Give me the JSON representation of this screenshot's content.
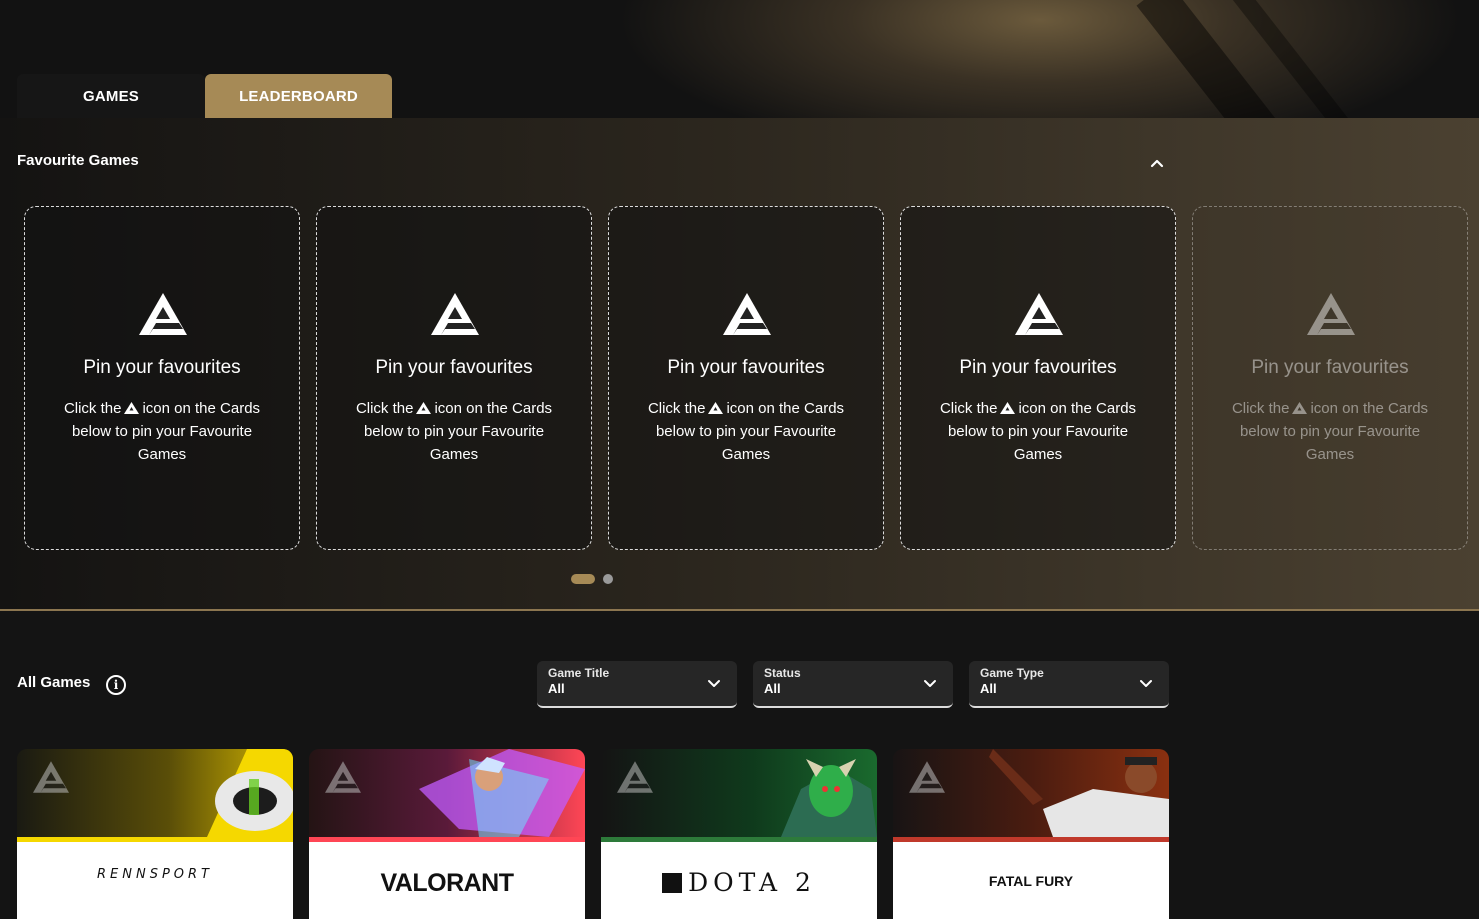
{
  "tabs": [
    {
      "label": "GAMES",
      "active": false
    },
    {
      "label": "LEADERBOARD",
      "active": true
    }
  ],
  "favourites": {
    "title": "Favourite Games",
    "collapse_icon": "chevron-up-icon",
    "card": {
      "title": "Pin your favourites",
      "desc_before": "Click the",
      "desc_after": "icon on the Cards below to pin your Favourite Games",
      "icon": "pin-logo-icon"
    },
    "pagination": {
      "pages": 2,
      "current": 1
    }
  },
  "all_games": {
    "title": "All Games",
    "info_icon": "i",
    "filters": [
      {
        "label": "Game Title",
        "value": "All"
      },
      {
        "label": "Status",
        "value": "All"
      },
      {
        "label": "Game Type",
        "value": "All"
      }
    ],
    "games": [
      {
        "name": "RENNSPORT",
        "accent": "#f5d800"
      },
      {
        "name": "VALORANT",
        "accent": "#ff4655"
      },
      {
        "name": "DOTA 2",
        "accent": "#2d7a3a"
      },
      {
        "name": "FATAL FURY",
        "accent": "#c0392b"
      }
    ]
  },
  "colors": {
    "brand": "#a68a56",
    "background": "#141414"
  }
}
